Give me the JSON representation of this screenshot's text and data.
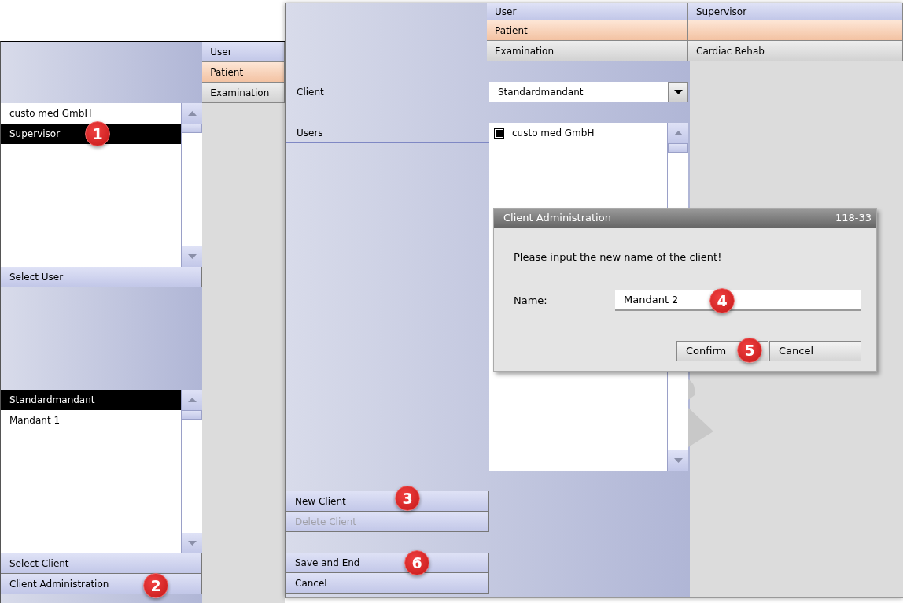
{
  "left_window": {
    "users": [
      {
        "label": "custo med GmbH",
        "selected": false
      },
      {
        "label": "Supervisor",
        "selected": true
      }
    ],
    "select_user": "Select User",
    "clients": [
      {
        "label": "Standardmandant",
        "selected": true
      },
      {
        "label": "Mandant 1",
        "selected": false
      }
    ],
    "buttons": [
      "Select Client",
      "Client Administration"
    ],
    "tabs": [
      {
        "label": "User",
        "kind": "user"
      },
      {
        "label": "Patient",
        "kind": "patient"
      },
      {
        "label": "Examination",
        "kind": "exam"
      }
    ]
  },
  "main_window": {
    "tabs": [
      {
        "label": "User",
        "value": "Supervisor",
        "kind": "user"
      },
      {
        "label": "Patient",
        "kind": "patient"
      },
      {
        "label": "Examination",
        "value": "Cardiac Rehab",
        "kind": "exam"
      }
    ],
    "client_label": "Client",
    "client_value": "Standardmandant",
    "users_label": "Users",
    "users": [
      {
        "label": "custo med GmbH",
        "checked": true
      }
    ],
    "buttons": [
      {
        "label": "New Client",
        "disabled": false
      },
      {
        "label": "Delete Client",
        "disabled": true
      }
    ],
    "footer_buttons": [
      "Save and End",
      "Cancel"
    ]
  },
  "dialog": {
    "title": "Client Administration",
    "code": "118-33",
    "message": "Please input the new name of the client!",
    "name_label": "Name:",
    "name_value": "Mandant 2",
    "buttons": [
      "Confirm",
      "Cancel"
    ]
  },
  "markers": [
    {
      "label": "1"
    },
    {
      "label": "2"
    },
    {
      "label": "3"
    },
    {
      "label": "4"
    },
    {
      "label": "5"
    },
    {
      "label": "6"
    }
  ]
}
